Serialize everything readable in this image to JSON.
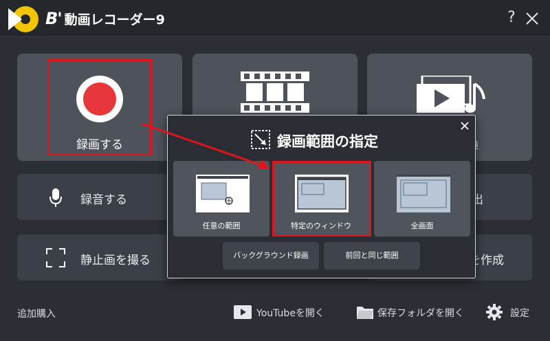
{
  "titlebar": {
    "app_title": "動画レコーダー9",
    "brand_mark": "B'",
    "help_label": "?"
  },
  "main": {
    "record_label": "録画する",
    "audio_label": "録音する",
    "still_label": "静止画を撮る",
    "right_row1_partial": "出",
    "right_row2_partial": "を作成",
    "conv_partial": "換"
  },
  "popup": {
    "title": "録画範囲の指定",
    "options": [
      {
        "label": "任意の範囲"
      },
      {
        "label": "特定のウィンドウ"
      },
      {
        "label": "全画面"
      }
    ],
    "sub_buttons": [
      {
        "label": "バックグラウンド録画"
      },
      {
        "label": "前回と同じ範囲"
      }
    ]
  },
  "footer": {
    "purchase_label": "追加購入",
    "youtube_label": "YouTubeを開く",
    "folder_label": "保存フォルダを開く",
    "settings_label": "設定"
  },
  "colors": {
    "accent_red": "#e1141b",
    "record_red": "#e8373a",
    "brand_yellow": "#f5c400",
    "tile": "#4d525b",
    "background": "#2b2f35"
  }
}
